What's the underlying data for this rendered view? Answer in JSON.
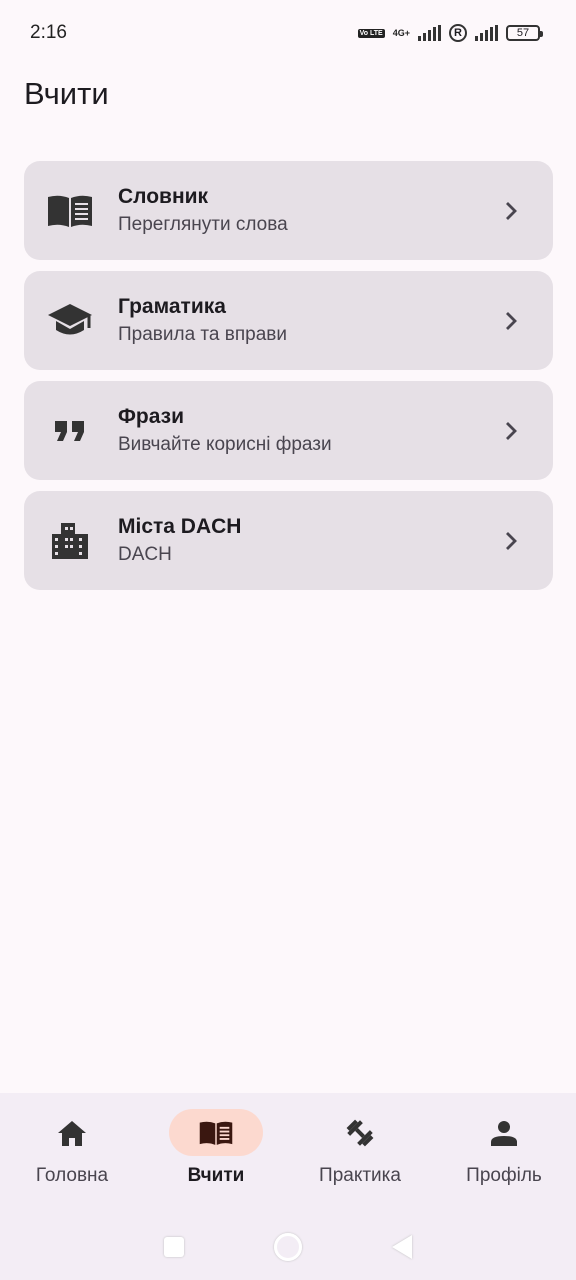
{
  "status": {
    "time": "2:16",
    "volte": "Vo LTE",
    "network": "4G+",
    "reg": "R",
    "battery": "57"
  },
  "page": {
    "title": "Вчити"
  },
  "items": [
    {
      "title": "Словник",
      "subtitle": "Переглянути слова",
      "icon": "book-icon"
    },
    {
      "title": "Граматика",
      "subtitle": "Правила та вправи",
      "icon": "school-icon"
    },
    {
      "title": "Фрази",
      "subtitle": "Вивчайте корисні фрази",
      "icon": "quote-icon"
    },
    {
      "title": "Міста DACH",
      "subtitle": "DACH",
      "icon": "city-icon"
    }
  ],
  "nav": [
    {
      "label": "Головна",
      "icon": "home-icon",
      "active": false
    },
    {
      "label": "Вчити",
      "icon": "book-icon",
      "active": true
    },
    {
      "label": "Практика",
      "icon": "dumbbell-icon",
      "active": false
    },
    {
      "label": "Профіль",
      "icon": "person-icon",
      "active": false
    }
  ],
  "colors": {
    "background": "#fdf8fb",
    "card": "#e6e0e6",
    "nav_active_pill": "#fcd9cf",
    "nav_bar": "#f3edf5"
  }
}
